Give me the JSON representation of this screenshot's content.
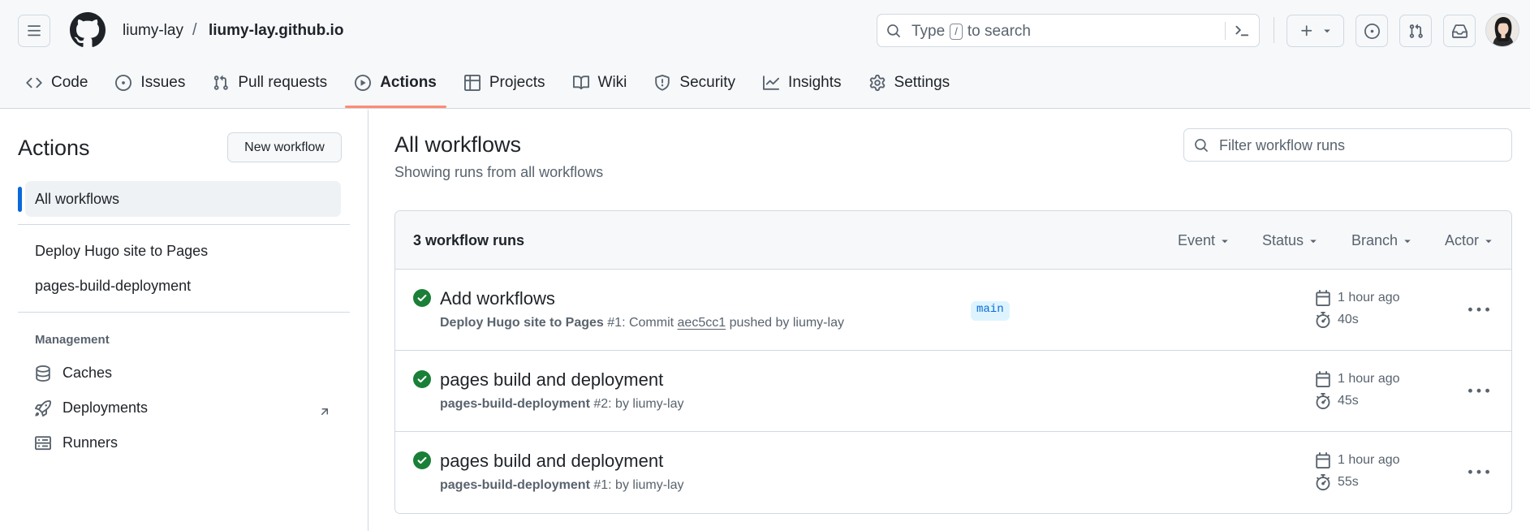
{
  "header": {
    "owner": "liumy-lay",
    "separator": "/",
    "repo": "liumy-lay.github.io",
    "search": {
      "before": "Type",
      "key": "/",
      "after": "to search"
    }
  },
  "nav": [
    {
      "label": "Code",
      "icon": "code-icon",
      "active": false
    },
    {
      "label": "Issues",
      "icon": "issue-opened-icon",
      "active": false
    },
    {
      "label": "Pull requests",
      "icon": "git-pull-request-icon",
      "active": false
    },
    {
      "label": "Actions",
      "icon": "play-icon",
      "active": true
    },
    {
      "label": "Projects",
      "icon": "table-icon",
      "active": false
    },
    {
      "label": "Wiki",
      "icon": "book-icon",
      "active": false
    },
    {
      "label": "Security",
      "icon": "shield-icon",
      "active": false
    },
    {
      "label": "Insights",
      "icon": "graph-icon",
      "active": false
    },
    {
      "label": "Settings",
      "icon": "gear-icon",
      "active": false
    }
  ],
  "sidebar": {
    "title": "Actions",
    "new_workflow": "New workflow",
    "all_workflows": "All workflows",
    "workflows": [
      "Deploy Hugo site to Pages",
      "pages-build-deployment"
    ],
    "section": "Management",
    "management": [
      {
        "label": "Caches",
        "icon": "database-icon"
      },
      {
        "label": "Deployments",
        "icon": "rocket-icon"
      },
      {
        "label": "Runners",
        "icon": "server-icon"
      }
    ]
  },
  "main": {
    "title": "All workflows",
    "subtitle": "Showing runs from all workflows",
    "filter_placeholder": "Filter workflow runs",
    "count": "3 workflow runs",
    "filters": [
      "Event",
      "Status",
      "Branch",
      "Actor"
    ],
    "runs": [
      {
        "title": "Add workflows",
        "workflow": "Deploy Hugo site to Pages",
        "meta_mid": "#1: Commit",
        "sha": "aec5cc1",
        "meta_end": "pushed by liumy-lay",
        "branch": "main",
        "time": "1 hour ago",
        "duration": "40s"
      },
      {
        "title": "pages build and deployment",
        "workflow": "pages-build-deployment",
        "meta_mid": "#2: by liumy-lay",
        "sha": "",
        "meta_end": "",
        "branch": "",
        "time": "1 hour ago",
        "duration": "45s"
      },
      {
        "title": "pages build and deployment",
        "workflow": "pages-build-deployment",
        "meta_mid": "#1: by liumy-lay",
        "sha": "",
        "meta_end": "",
        "branch": "",
        "time": "1 hour ago",
        "duration": "55s"
      }
    ]
  },
  "colors": {
    "accent": "#0969da",
    "success": "#1a7f37",
    "active_underline": "#fd8c73",
    "border": "#d1d9e0"
  }
}
